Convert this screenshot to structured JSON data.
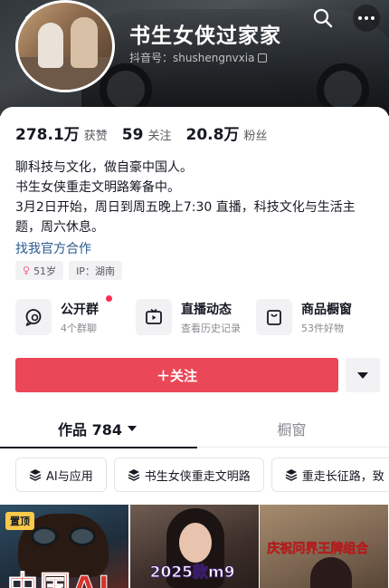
{
  "header": {
    "name": "书生女侠过家家",
    "id_label": "抖音号：",
    "id_value": "shushengnvxia"
  },
  "stats": [
    {
      "num": "278.1万",
      "label": "获赞"
    },
    {
      "num": "59",
      "label": "关注"
    },
    {
      "num": "20.8万",
      "label": "粉丝"
    }
  ],
  "bio": {
    "lines": [
      "聊科技与文化，做自豪中国人。",
      "书生女侠重走文明路筹备中。",
      "3月2日开始，周日到周五晚上7:30 直播，科技文化与生活主题，周六休息。"
    ],
    "link": "找我官方合作"
  },
  "tags": {
    "age": "51岁",
    "ip": "IP：湖南"
  },
  "features": [
    {
      "title": "公开群",
      "sub": "4个群聊"
    },
    {
      "title": "直播动态",
      "sub": "查看历史记录"
    },
    {
      "title": "商品橱窗",
      "sub": "53件好物"
    }
  ],
  "follow": {
    "label": "＋关注"
  },
  "tabs": {
    "works": "作品 784",
    "shop": "橱窗"
  },
  "chips": [
    "AI与应用",
    "书生女侠重走文明路",
    "重走长征路，致"
  ],
  "videos": [
    {
      "badge": "置顶",
      "text": "中国AI"
    },
    {
      "text": "2025款m9"
    },
    {
      "text": "庆祝问界王牌组合"
    }
  ],
  "colors": {
    "follow": "#ea4757",
    "link": "#2a5b8f",
    "badge": "#f8c94a"
  }
}
